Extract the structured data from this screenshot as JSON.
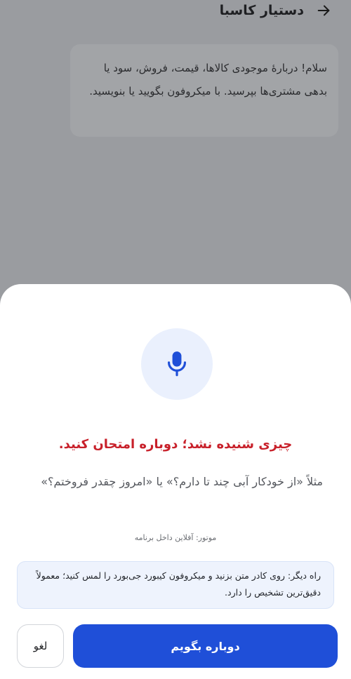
{
  "header": {
    "title": "دستیار کاسبا",
    "back_icon": "arrow-right-icon"
  },
  "chat": {
    "welcome_message": "سلام! دربارهٔ موجودی کالاها، قیمت، فروش، سود یا بدهی مشتری‌ها بپرسید. با میکروفون بگویید یا بنویسید."
  },
  "voice_sheet": {
    "mic_icon": "microphone-icon",
    "error_message": "چیزی شنیده نشد؛ دوباره امتحان کنید.",
    "example_text": "مثلاً «از خودکار آبی چند تا دارم؟» یا «امروز چقدر فروختم؟»",
    "engine_label": "موتور: آفلاین داخل برنامه",
    "tip_text": "راه دیگر: روی کادر متن بزنید و میکروفون کیبورد جی‌بورد را لمس کنید؛ معمولاً دقیق‌ترین تشخیص را دارد.",
    "retry_button": "دوباره بگویم",
    "cancel_button": "لغو"
  },
  "colors": {
    "accent": "#1f4fd8",
    "error": "#c8202a",
    "mic_bg": "#eaf0fd",
    "tip_bg": "#eef3fd",
    "dim_overlay": "#9a9ca0"
  }
}
